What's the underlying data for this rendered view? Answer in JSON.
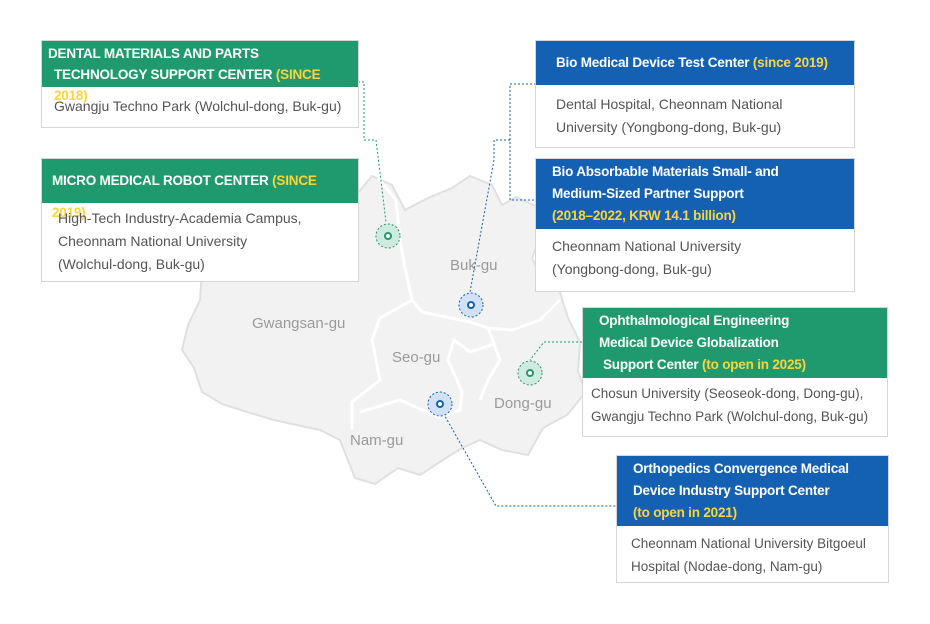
{
  "districts": {
    "bukgu": "Buk-gu",
    "gwangsangu": "Gwangsan-gu",
    "seogu": "Seo-gu",
    "donggu": "Dong-gu",
    "namgu": "Nam-gu"
  },
  "colors": {
    "map_fill": "#f2f2f2",
    "map_stroke": "#e0e0e0",
    "district_border": "#ffffff",
    "green": "#1f9a6e",
    "blue": "#1461b3",
    "accent_yellow": "#ffd43b"
  },
  "centers": {
    "dental": {
      "title_line1": "DENTAL MATERIALS AND PARTS",
      "title_line2": "TECHNOLOGY SUPPORT CENTER",
      "period": "(SINCE 2018)",
      "location": "Gwangju Techno Park (Wolchul-dong, Buk-gu)"
    },
    "robot": {
      "title": "MICRO MEDICAL ROBOT CENTER",
      "period": "(SINCE 2019)",
      "location_line1": "High-Tech Industry-Academia Campus,",
      "location_line2": "Cheonnam National University",
      "location_line3": "(Wolchul-dong, Buk-gu)"
    },
    "biotest": {
      "title": "Bio Medical Device Test Center",
      "period": "(since 2019)",
      "location_line1": "Dental Hospital, Cheonnam National",
      "location_line2": "University (Yongbong-dong, Buk-gu)"
    },
    "bioabsorb": {
      "title_line1": "Bio Absorbable Materials Small- and",
      "title_line2": "Medium-Sized Partner Support",
      "period": "(2018–2022, KRW 14.1 billion)",
      "location_line1": "Cheonnam National University",
      "location_line2": "(Yongbong-dong, Buk-gu)"
    },
    "ophthal": {
      "title_line1": "Ophthalmological Engineering",
      "title_line2": "Medical Device Globalization",
      "title_line3": "Support Center",
      "period": "(to open in 2025)",
      "location_line1": "Chosun University (Seoseok-dong, Dong-gu),",
      "location_line2": "Gwangju Techno Park (Wolchul-dong, Buk-gu)"
    },
    "ortho": {
      "title_line1": "Orthopedics Convergence Medical",
      "title_line2": "Device Industry Support Center",
      "period": "(to open in 2021)",
      "location_line1": "Cheonnam National University Bitgoeul",
      "location_line2": "Hospital (Nodae-dong, Nam-gu)"
    }
  },
  "markers": [
    {
      "id": "robot-dental",
      "color": "green"
    },
    {
      "id": "bio",
      "color": "blue"
    },
    {
      "id": "ophthal",
      "color": "green"
    },
    {
      "id": "ortho",
      "color": "blue"
    }
  ]
}
